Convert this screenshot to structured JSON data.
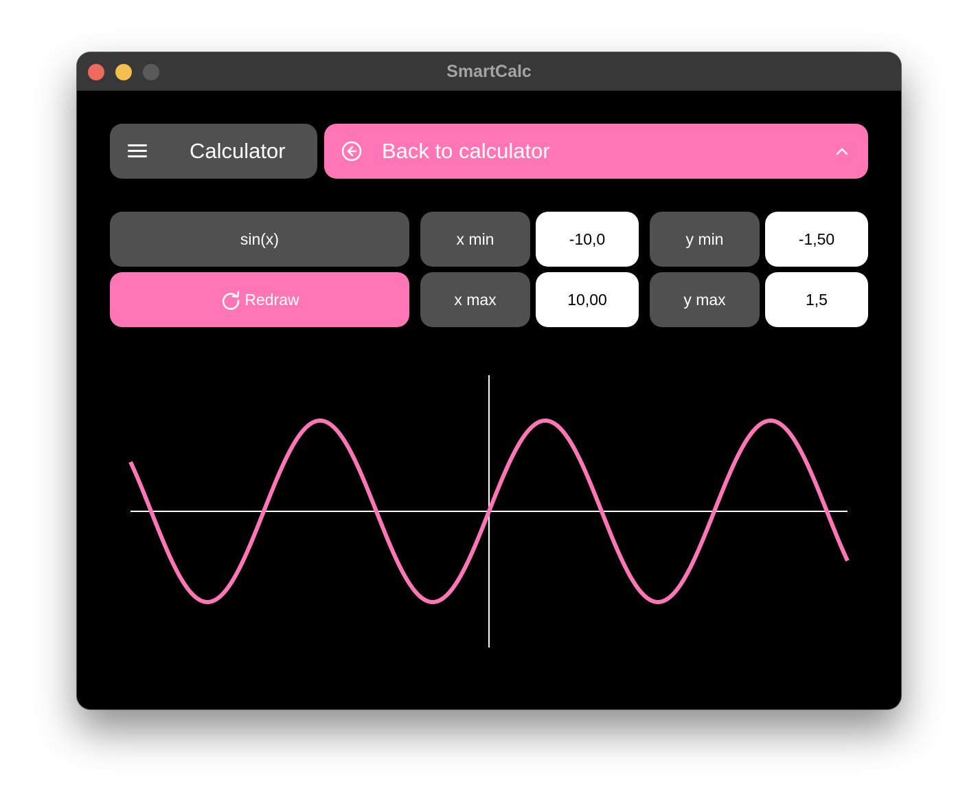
{
  "window": {
    "title": "SmartCalc"
  },
  "header": {
    "menu_label": "Calculator",
    "back_label": "Back to calculator"
  },
  "controls": {
    "function": "sin(x)",
    "redraw_label": "Redraw",
    "x_min_label": "x min",
    "x_min_value": "-10,0",
    "x_max_label": "x max",
    "x_max_value": "10,00",
    "y_min_label": "y min",
    "y_min_value": "-1,50",
    "y_max_label": "y max",
    "y_max_value": "1,5"
  },
  "colors": {
    "accent": "#ff76b6",
    "button_gray": "#505050",
    "background": "#000000",
    "axis": "#ffffff"
  },
  "chart_data": {
    "type": "line",
    "function": "sin(x)",
    "xlim": [
      -10,
      10
    ],
    "ylim": [
      -1.5,
      1.5
    ],
    "series": [
      {
        "x_range": [
          -10,
          10
        ],
        "expression": "sin(x)",
        "color": "#ff76b6"
      }
    ]
  }
}
